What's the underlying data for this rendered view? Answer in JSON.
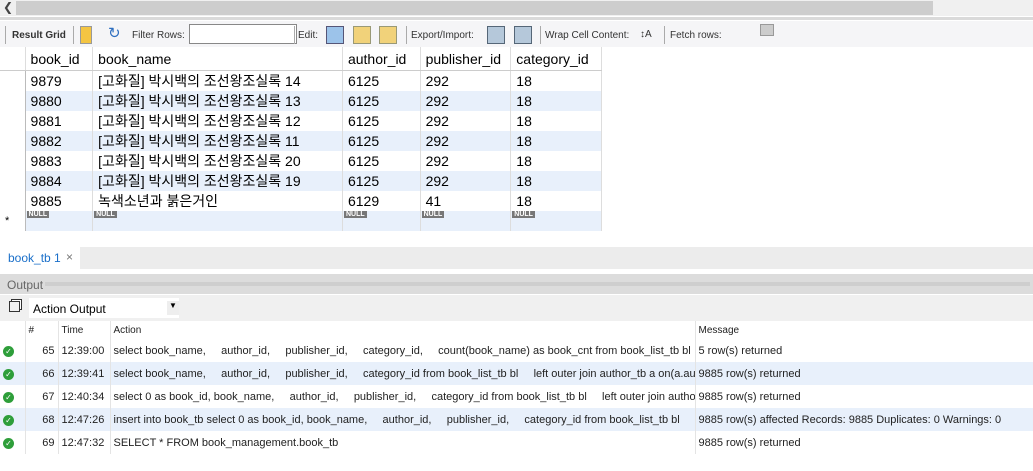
{
  "toolbar": {
    "result_grid": "Result Grid",
    "filter_rows": "Filter Rows:",
    "filter_value": "",
    "edit": "Edit:",
    "export_import": "Export/Import:",
    "wrap": "Wrap Cell Content:",
    "fetch": "Fetch rows:"
  },
  "grid": {
    "columns": [
      "book_id",
      "book_name",
      "author_id",
      "publisher_id",
      "category_id"
    ],
    "rows": [
      [
        "9879",
        "[고화질] 박시백의 조선왕조실록 14",
        "6125",
        "292",
        "18"
      ],
      [
        "9880",
        "[고화질] 박시백의 조선왕조실록 13",
        "6125",
        "292",
        "18"
      ],
      [
        "9881",
        "[고화질] 박시백의 조선왕조실록 12",
        "6125",
        "292",
        "18"
      ],
      [
        "9882",
        "[고화질] 박시백의 조선왕조실록 11",
        "6125",
        "292",
        "18"
      ],
      [
        "9883",
        "[고화질] 박시백의 조선왕조실록 20",
        "6125",
        "292",
        "18"
      ],
      [
        "9884",
        "[고화질] 박시백의 조선왕조실록 19",
        "6125",
        "292",
        "18"
      ],
      [
        "9885",
        "녹색소년과 붉은거인",
        "6129",
        "41",
        "18"
      ]
    ],
    "null_label": "NULL",
    "new_row_marker": "*"
  },
  "tab": {
    "label": "book_tb 1",
    "close": "×"
  },
  "output": {
    "title": "Output",
    "selector": "Action Output",
    "columns": [
      "#",
      "Time",
      "Action",
      "Message"
    ],
    "rows": [
      {
        "n": "65",
        "time": "12:39:00",
        "action": "select book_name,     author_id,     publisher_id,     category_id,     count(book_name) as book_cnt from book_list_tb bl  ...",
        "msg": "5 row(s) returned"
      },
      {
        "n": "66",
        "time": "12:39:41",
        "action": "select book_name,     author_id,     publisher_id,     category_id from book_list_tb bl     left outer join author_tb a on(a.aut...",
        "msg": "9885 row(s) returned"
      },
      {
        "n": "67",
        "time": "12:40:34",
        "action": "select 0 as book_id, book_name,     author_id,     publisher_id,     category_id from book_list_tb bl     left outer join author...",
        "msg": "9885 row(s) returned"
      },
      {
        "n": "68",
        "time": "12:47:26",
        "action": "insert into book_tb select 0 as book_id, book_name,     author_id,     publisher_id,     category_id from book_list_tb bl     l...",
        "msg": "9885 row(s) affected Records: 9885  Duplicates: 0  Warnings: 0"
      },
      {
        "n": "69",
        "time": "12:47:32",
        "action": "SELECT * FROM book_management.book_tb",
        "msg": "9885 row(s) returned"
      }
    ]
  }
}
